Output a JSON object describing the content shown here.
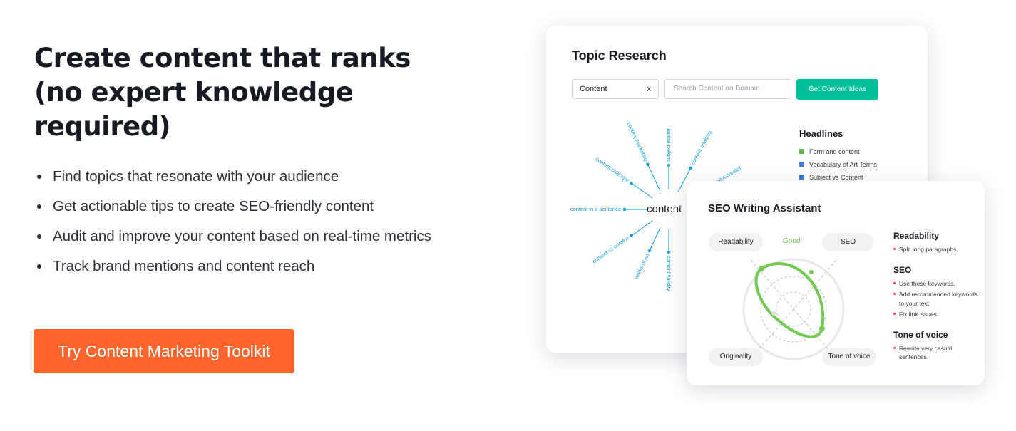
{
  "hero": {
    "headline": "Create content that ranks (no expert knowledge required)",
    "features": [
      "Find topics that resonate with your audience",
      "Get actionable tips to create SEO-friendly content",
      "Audit and improve your content based on real-time metrics",
      "Track brand mentions and content reach"
    ],
    "cta_label": "Try Content Marketing Toolkit"
  },
  "topic_research": {
    "title": "Topic Research",
    "input_value": "Content",
    "clear_label": "x",
    "search_placeholder": "Search Content on Domain",
    "button_label": "Get Content Ideas",
    "mindmap": {
      "center": "content",
      "spokes": [
        "content in a sentence",
        "content calendar",
        "content marketing",
        "subject matter",
        "content analysis",
        "content creator",
        "content vs context",
        "works of art",
        "content validity"
      ]
    },
    "headlines_title": "Headlines",
    "headlines": [
      {
        "text": "Form and content",
        "icon": "green-square-icon",
        "color": "#5fbf4a"
      },
      {
        "text": "Vocabulary of Art Terms",
        "icon": "blue-square-icon",
        "color": "#3b7de0"
      },
      {
        "text": "Subject vs Content",
        "icon": "blue-square-icon",
        "color": "#3b7de0"
      }
    ]
  },
  "seo_assistant": {
    "title": "SEO Writing Assistant",
    "status": "Good",
    "axes": [
      "Readability",
      "SEO",
      "Originality",
      "Tone of voice"
    ],
    "sections": [
      {
        "title": "Readability",
        "items": [
          "Split long paragraphs."
        ]
      },
      {
        "title": "SEO",
        "items": [
          "Use these keywords.",
          "Add recommended keywords to your text",
          "Fix link issues."
        ]
      },
      {
        "title": "Tone of voice",
        "items": [
          "Rewrite very casual sentences."
        ]
      }
    ]
  },
  "colors": {
    "cta": "#FF642D",
    "accent_green": "#00C19A",
    "mindmap_blue": "#0aa0e6",
    "good_green": "#6cc94a",
    "alert_red": "#f0364a"
  }
}
